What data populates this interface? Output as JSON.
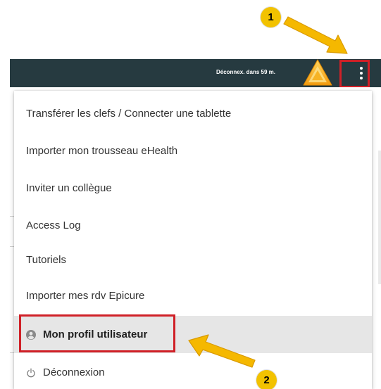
{
  "topbar": {
    "session_text": "Déconnex. dans 59 m.",
    "logo_icon": "triangle-logo-icon",
    "menu_button_icon": "kebab-menu-icon",
    "background_color": "#263a40"
  },
  "menu": {
    "items": [
      {
        "label": "Transférer les clefs / Connecter une tablette"
      },
      {
        "label": "Importer mon trousseau eHealth"
      },
      {
        "label": "Inviter un collègue"
      },
      {
        "label": "Access Log"
      },
      {
        "label": "Tutoriels"
      },
      {
        "label": "Importer mes rdv Epicure"
      },
      {
        "label": "Mon profil utilisateur",
        "icon": "user-circle-icon",
        "active": true
      },
      {
        "label": "Déconnexion",
        "icon": "power-icon"
      }
    ]
  },
  "annotations": {
    "step1": "1",
    "step2": "2",
    "highlight_color": "#d02027",
    "arrow_color": "#f5b800"
  }
}
